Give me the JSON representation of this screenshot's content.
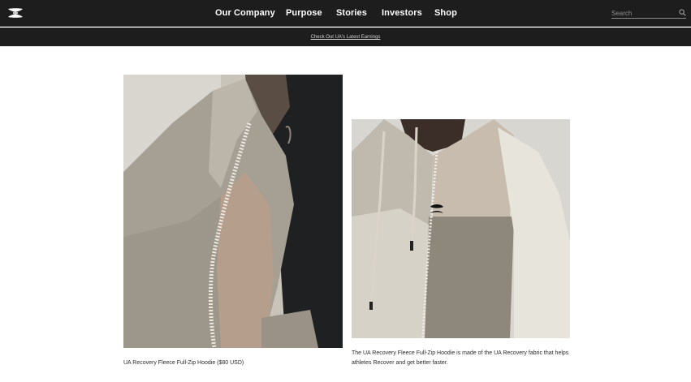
{
  "header": {
    "logo_name": "under-armour-logo",
    "nav": [
      {
        "label": "Our Company"
      },
      {
        "label": "Purpose"
      },
      {
        "label": "Stories"
      },
      {
        "label": "Investors"
      },
      {
        "label": "Shop"
      }
    ],
    "search": {
      "placeholder": "Search",
      "value": "",
      "icon": "search-icon"
    }
  },
  "promo": {
    "link_text": "Check Out UA's Latest Earnings"
  },
  "gallery": {
    "left": {
      "caption": "UA Recovery Fleece Full-Zip Hoodie ($80 USD)"
    },
    "right": {
      "caption": "The UA Recovery Fleece Full-Zip Hoodie is made of the UA Recovery fabric that helps athletes Recover and get better faster."
    }
  },
  "colors": {
    "nav_background": "#1d1d1d",
    "text": "#ffffff",
    "page_background": "#ffffff"
  }
}
